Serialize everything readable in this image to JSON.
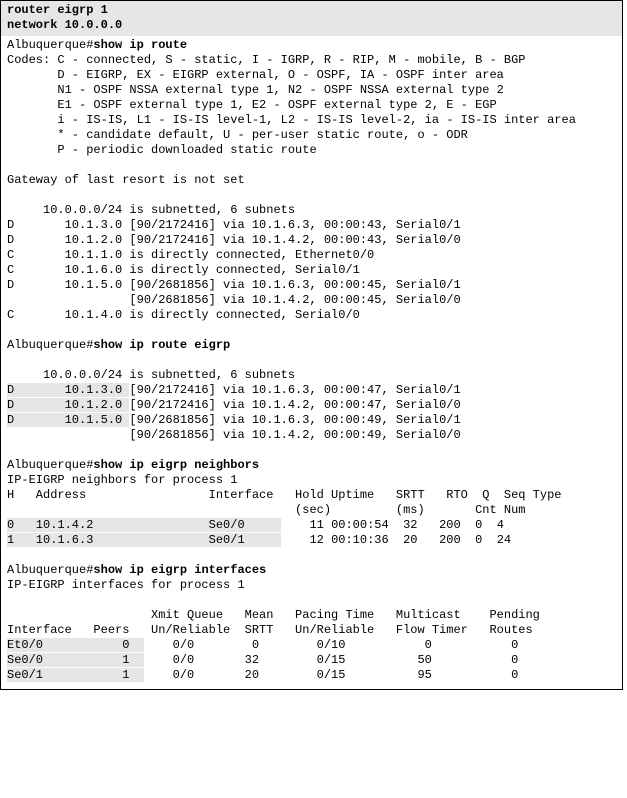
{
  "header": {
    "line1": "router eigrp 1",
    "line2": "network 10.0.0.0"
  },
  "section1": {
    "prompt": "Albuquerque#",
    "cmd": "show ip route",
    "codes": [
      "Codes: C - connected, S - static, I - IGRP, R - RIP, M - mobile, B - BGP",
      "       D - EIGRP, EX - EIGRP external, O - OSPF, IA - OSPF inter area",
      "       N1 - OSPF NSSA external type 1, N2 - OSPF NSSA external type 2",
      "       E1 - OSPF external type 1, E2 - OSPF external type 2, E - EGP",
      "       i - IS-IS, L1 - IS-IS level-1, L2 - IS-IS level-2, ia - IS-IS inter area",
      "       * - candidate default, U - per-user static route, o - ODR",
      "       P - periodic downloaded static route"
    ],
    "gateway": "Gateway of last resort is not set",
    "subnet": "     10.0.0.0/24 is subnetted, 6 subnets",
    "routes": [
      "D       10.1.3.0 [90/2172416] via 10.1.6.3, 00:00:43, Serial0/1",
      "D       10.1.2.0 [90/2172416] via 10.1.4.2, 00:00:43, Serial0/0",
      "C       10.1.1.0 is directly connected, Ethernet0/0",
      "C       10.1.6.0 is directly connected, Serial0/1",
      "D       10.1.5.0 [90/2681856] via 10.1.6.3, 00:00:45, Serial0/1",
      "                 [90/2681856] via 10.1.4.2, 00:00:45, Serial0/0",
      "C       10.1.4.0 is directly connected, Serial0/0"
    ]
  },
  "section2": {
    "prompt": "Albuquerque#",
    "cmd": "show ip route eigrp",
    "subnet": "     10.0.0.0/24 is subnetted, 6 subnets",
    "rows": [
      {
        "hl": "D       10.1.3.0 ",
        "rest": "[90/2172416] via 10.1.6.3, 00:00:47, Serial0/1"
      },
      {
        "hl": "D       10.1.2.0 ",
        "rest": "[90/2172416] via 10.1.4.2, 00:00:47, Serial0/0"
      },
      {
        "hl": "D       10.1.5.0 ",
        "rest": "[90/2681856] via 10.1.6.3, 00:00:49, Serial0/1"
      }
    ],
    "tail": "                 [90/2681856] via 10.1.4.2, 00:00:49, Serial0/0"
  },
  "section3": {
    "prompt": "Albuquerque#",
    "cmd": "show ip eigrp neighbors",
    "title": "IP-EIGRP neighbors for process 1",
    "head1": "H   Address                 Interface   Hold Uptime   SRTT   RTO  Q  Seq Type",
    "head2": "                                        (sec)         (ms)       Cnt Num",
    "rows": [
      {
        "hl": "0   10.1.4.2                Se0/0     ",
        "rest": "    11 00:00:54  32   200  0  4"
      },
      {
        "hl": "1   10.1.6.3                Se0/1     ",
        "rest": "    12 00:10:36  20   200  0  24"
      }
    ]
  },
  "section4": {
    "prompt": "Albuquerque#",
    "cmd": "show ip eigrp interfaces",
    "title": "IP-EIGRP interfaces for process 1",
    "head1": "                    Xmit Queue   Mean   Pacing Time   Multicast    Pending",
    "head2": "Interface   Peers   Un/Reliable  SRTT   Un/Reliable   Flow Timer   Routes",
    "rows": [
      {
        "hl": "Et0/0           0  ",
        "rest": "    0/0        0        0/10           0           0"
      },
      {
        "hl": "Se0/0           1  ",
        "rest": "    0/0       32        0/15          50           0"
      },
      {
        "hl": "Se0/1           1  ",
        "rest": "    0/0       20        0/15          95           0"
      }
    ]
  }
}
